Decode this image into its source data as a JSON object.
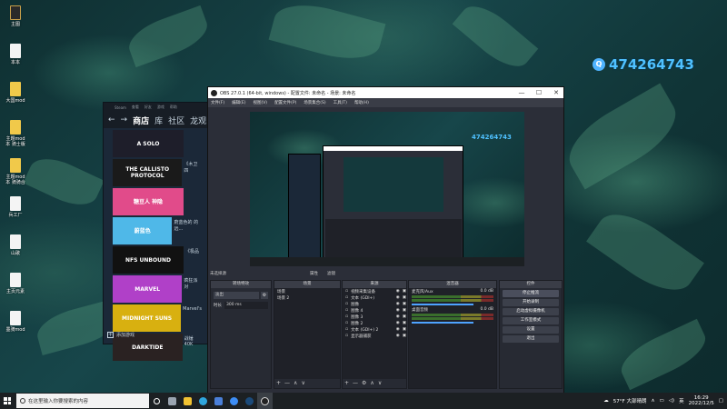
{
  "desktop": {
    "icons": [
      {
        "label": "主图",
        "style": "dark"
      },
      {
        "label": "本本",
        "style": "light"
      },
      {
        "label": "大国mod",
        "style": "yellow"
      },
      {
        "label": "主题mod本\n骑士版",
        "style": "yellow"
      },
      {
        "label": "主题mod本\n骑骑合",
        "style": "yellow"
      },
      {
        "label": "兵工厂",
        "style": "light"
      },
      {
        "label": "山歌",
        "style": "light"
      },
      {
        "label": "主页元素",
        "style": "light"
      },
      {
        "label": "墨骑mod",
        "style": "light"
      }
    ],
    "qq_number": "474264743"
  },
  "steam": {
    "top_menu": [
      "Steam",
      "查看",
      "好友",
      "游戏",
      "帮助"
    ],
    "nav": {
      "back": "←",
      "forward": "→",
      "store": "商店",
      "library": "库",
      "community": "社区",
      "user": "龙观"
    },
    "games": [
      {
        "thumb": "A SOLO",
        "text": "",
        "color": "#1e1e2a"
      },
      {
        "thumb": "THE CALLISTO PROTOCOL",
        "text": "《木卫四",
        "color": "#1a1a1a"
      },
      {
        "thumb": "糖豆人 神隐",
        "text": "",
        "color": "#e14b8a"
      },
      {
        "thumb": "蔚蓝色",
        "text": "蔚蓝色的\n的远...",
        "color": "#4fb8e8"
      },
      {
        "thumb": "NFS UNBOUND",
        "text": "《极品",
        "color": "#111111"
      },
      {
        "thumb": "MARVEL",
        "text": "疯狂派对",
        "color": "#b040c8"
      },
      {
        "thumb": "MIDNIGHT SUNS",
        "text": "Marvel's",
        "color": "#d8b010"
      },
      {
        "thumb": "DARKTIDE",
        "text": "战锤40K",
        "color": "#2a2222"
      }
    ],
    "add_game": "添加游戏"
  },
  "obs": {
    "title": "OBS 27.0.1 (64-bit, windows) - 配置文件: 未命名 - 场景: 未命名",
    "window_buttons": [
      "—",
      "☐",
      "✕"
    ],
    "menu": [
      "文件(F)",
      "编辑(E)",
      "视图(V)",
      "配置文件(P)",
      "场景集合(S)",
      "工具(T)",
      "帮助(H)"
    ],
    "scene_label": "未选择源",
    "preview_controls": [
      "属性",
      "滤镜"
    ],
    "docks": {
      "scene_transitions": {
        "title": "转场特效",
        "fade": "淡出",
        "duration_label": "时长",
        "duration_value": "300 ms"
      },
      "scenes": {
        "title": "场景",
        "items": [
          "场景",
          "场景 2"
        ]
      },
      "sources": {
        "title": "来源",
        "items": [
          "视频采集设备",
          "文本 (GDI+)",
          "图像",
          "图像 4",
          "图像 3",
          "图像 2",
          "文本 (GDI+) 2",
          "显示器捕获"
        ]
      },
      "mixer": {
        "title": "混音器",
        "channels": [
          {
            "name": "麦克风/Aux",
            "db": "0.0 dB"
          },
          {
            "name": "桌面音频",
            "db": "0.0 dB"
          }
        ]
      },
      "controls": {
        "title": "控件",
        "buttons": [
          "停止推流",
          "开始录制",
          "启动虚拟摄像机",
          "工作室模式",
          "设置",
          "退出"
        ]
      }
    },
    "status": [
      "LIVE: 00:00:00",
      "REC: 00:00:00",
      "CPU: 2.3%, 30.00 fps"
    ]
  },
  "taskbar": {
    "search_placeholder": "在这里输入你要搜索的内容",
    "weather": "57°F 大部晴朗",
    "lang": "英",
    "time": "16:29",
    "date": "2022/12/5"
  },
  "colors": {
    "accent": "#4fc1ff",
    "obs_bg": "#2b2e38",
    "steam_bg": "#1b2838"
  }
}
